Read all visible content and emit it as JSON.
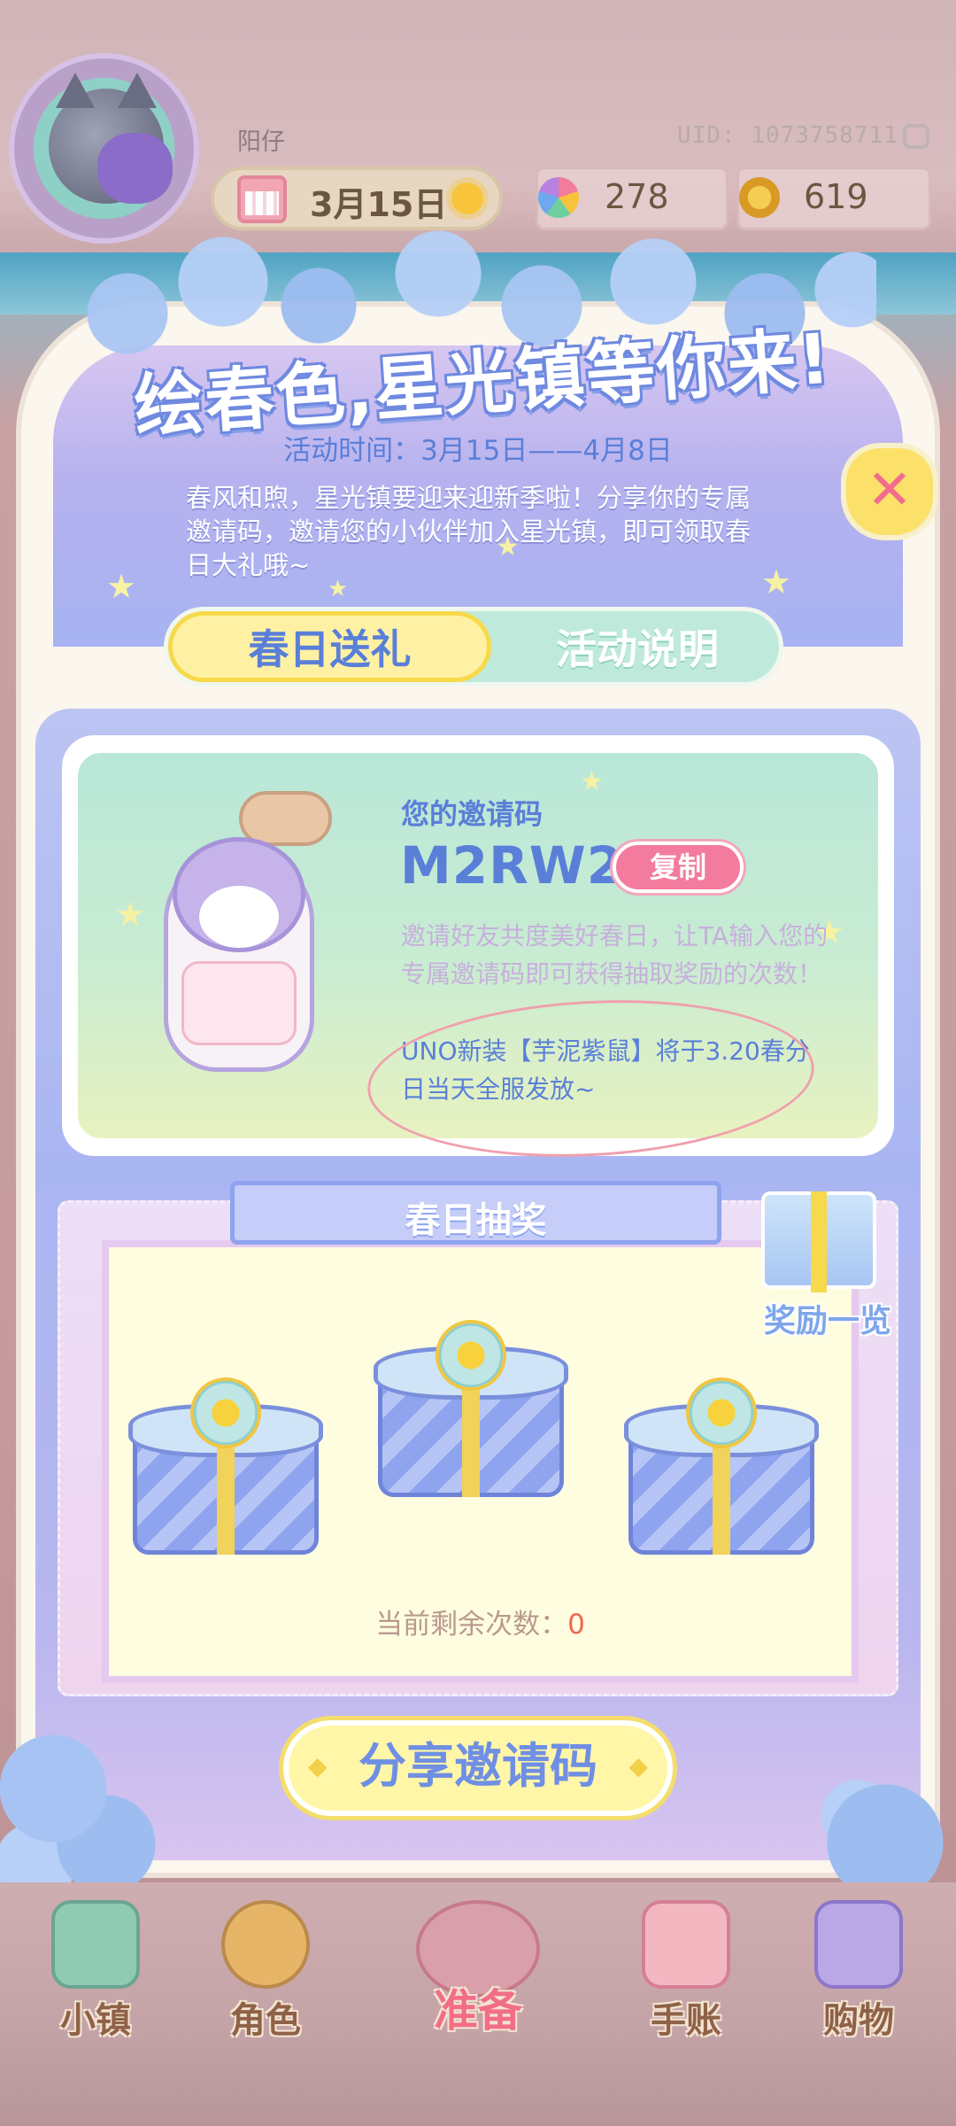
{
  "header": {
    "username": "阳仔",
    "uid": "UID: 1073758711",
    "date": "3月15日",
    "resources": [
      {
        "icon": "rainbow-flower-icon",
        "value": "278"
      },
      {
        "icon": "gold-coin-icon",
        "value": "619"
      }
    ]
  },
  "event": {
    "title": "绘春色,星光镇等你来!",
    "time": "活动时间：3月15日——4月8日",
    "intro": "春风和煦，星光镇要迎来迎新季啦！分享你的专属邀请码，邀请您的小伙伴加入星光镇，即可领取春日大礼哦~",
    "close_label": "✕",
    "tabs": [
      {
        "label": "春日送礼",
        "active": true
      },
      {
        "label": "活动说明",
        "active": false
      }
    ]
  },
  "invite": {
    "label": "您的邀请码",
    "code": "M2RW24",
    "copy_label": "复制",
    "description": "邀请好友共度美好春日，让TA输入您的专属邀请码即可获得抽取奖励的次数！",
    "notice": "UNO新装【芋泥紫鼠】将于3.20春分日当天全服发放~"
  },
  "lottery": {
    "title": "春日抽奖",
    "reward_list_label": "奖励一览",
    "remaining_label": "当前剩余次数：",
    "remaining_count": "0"
  },
  "share_label": "分享邀请码",
  "nav": [
    {
      "label": "小镇",
      "icon": "town-map-icon",
      "active": false
    },
    {
      "label": "角色",
      "icon": "character-icon",
      "active": false
    },
    {
      "label": "准备",
      "icon": "prepare-icon",
      "active": true
    },
    {
      "label": "手账",
      "icon": "journal-icon",
      "active": false
    },
    {
      "label": "购物",
      "icon": "shopping-bag-icon",
      "active": false
    }
  ],
  "colors": {
    "accent_blue": "#5a7fd8",
    "copy_pink": "#f27b9e",
    "tab_yellow": "#fff1a4",
    "remaining_red": "#f0664e"
  }
}
